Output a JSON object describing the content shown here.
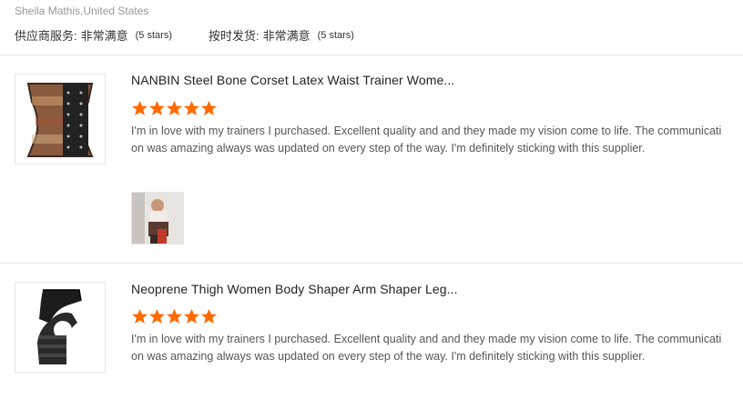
{
  "reviewer": {
    "name_location": "Sheila Mathis,United States"
  },
  "ratings": [
    {
      "label": "供应商服务:",
      "value": "非常满意",
      "stars_note": "(5 stars)"
    },
    {
      "label": "按时发货:",
      "value": "非常满意",
      "stars_note": "(5 stars)"
    }
  ],
  "reviews": [
    {
      "title": "NANBIN Steel Bone Corset Latex Waist Trainer Wome...",
      "rating": 5,
      "text": "I'm in love with my trainers I purchased. Excellent quality and and they made my vision come to life. The communication was amazing always was updated on every step of the way. I'm definitely sticking with this supplier.",
      "thumb_icon": "corset-product-image",
      "photo_icon": "customer-photo"
    },
    {
      "title": "Neoprene Thigh Women Body Shaper Arm Shaper Leg...",
      "rating": 5,
      "text": "I'm in love with my trainers I purchased. Excellent quality and and they made my vision come to life. The communication was amazing always was updated on every step of the way. I'm definitely sticking with this supplier.",
      "thumb_icon": "thigh-shaper-product-image"
    }
  ],
  "colors": {
    "star": "#ff6a00",
    "divider": "#e6e6e6"
  }
}
